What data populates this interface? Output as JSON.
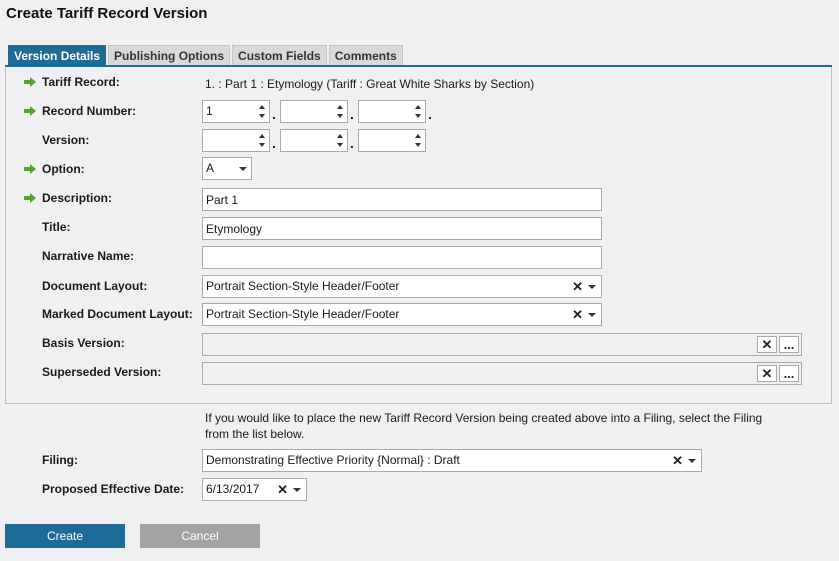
{
  "page": {
    "title": "Create Tariff Record Version"
  },
  "tabs": [
    {
      "label": "Version Details"
    },
    {
      "label": "Publishing Options"
    },
    {
      "label": "Custom Fields"
    },
    {
      "label": "Comments"
    }
  ],
  "fields": {
    "tariff_record": {
      "label": "Tariff Record:",
      "value": "1. : Part 1 : Etymology (Tariff : Great White Sharks by Section)"
    },
    "record_number": {
      "label": "Record Number:",
      "parts": [
        "1",
        "",
        ""
      ]
    },
    "version": {
      "label": "Version:",
      "parts": [
        "",
        "",
        ""
      ]
    },
    "option": {
      "label": "Option:",
      "value": "A"
    },
    "description": {
      "label": "Description:",
      "value": "Part 1"
    },
    "title": {
      "label": "Title:",
      "value": "Etymology"
    },
    "narrative_name": {
      "label": "Narrative Name:",
      "value": ""
    },
    "document_layout": {
      "label": "Document Layout:",
      "value": "Portrait Section-Style Header/Footer"
    },
    "marked_document_layout": {
      "label": "Marked Document Layout:",
      "value": "Portrait Section-Style Header/Footer"
    },
    "basis_version": {
      "label": "Basis Version:",
      "value": ""
    },
    "superseded_version": {
      "label": "Superseded Version:",
      "value": ""
    }
  },
  "filing_note": "If you would like to place the new Tariff Record Version being created above into a Filing, select the Filing from the list below.",
  "filing": {
    "label": "Filing:",
    "value": "Demonstrating Effective Priority {Normal} : Draft"
  },
  "proposed_effective_date": {
    "label": "Proposed Effective Date:",
    "value": "6/13/2017"
  },
  "glyphs": {
    "dot": ".",
    "clear": "✕",
    "lookup_clear": "✕",
    "lookup_more": "..."
  },
  "buttons": {
    "create": "Create",
    "cancel": "Cancel"
  },
  "colors": {
    "accent": "#1f6b98",
    "required_arrow": "#5aa02c",
    "cancel": "#a3a3a6"
  }
}
